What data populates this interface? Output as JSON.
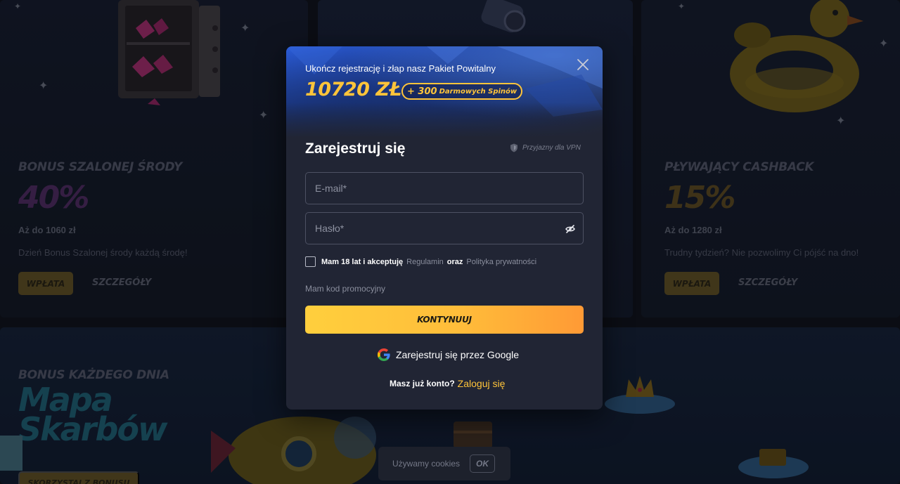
{
  "background": {
    "left_promo": {
      "title": "BONUS SZALONEJ ŚRODY",
      "percent": "40%",
      "upto": "Aż do 1060 zł",
      "description": "Dzień Bonus Szalonej środy każdą środę!",
      "deposit_label": "WPŁATA",
      "details_label": "SZCZEGÓŁY",
      "percent_color": "#5a2f6e"
    },
    "right_promo": {
      "title": "PŁYWAJĄCY CASHBACK",
      "percent": "15%",
      "upto": "Aż do 1280 zł",
      "description": "Trudny tydzień? Nie pozwolimy Ci pójść na dno!",
      "deposit_label": "WPŁATA",
      "details_label": "SZCZEGÓŁY",
      "percent_color": "#6b5320"
    },
    "bottom_promo": {
      "kicker": "BONUS KAŻDEGO DNIA",
      "title_line1": "Mapa",
      "title_line2": "Skarbów",
      "cta_label": "SKORZYSTAJ Z BONUSU"
    }
  },
  "cookie_bar": {
    "text": "Używamy cookies",
    "ok_label": "OK"
  },
  "modal": {
    "banner_lead": "Ukończ rejestrację i złap nasz Pakiet Powitalny",
    "amount": "10720 ZŁ",
    "spins_count": "+ 300",
    "spins_label": "Darmowych Spinów",
    "title": "Zarejestruj się",
    "vpn_label": "Przyjazny dla VPN",
    "email_placeholder": "E-mail*",
    "password_placeholder": "Hasło*",
    "terms_prefix": "Mam 18 lat i akceptuję",
    "terms_link1": "Regulamin",
    "terms_and": "oraz",
    "terms_link2": "Polityka prywatności",
    "promo_code_label": "Mam kod promocyjny",
    "continue_label": "KONTYNUUJ",
    "google_label": "Zarejestruj się przez Google",
    "login_question": "Masz już konto?",
    "login_link": "Zaloguj się"
  },
  "colors": {
    "accent_gold": "#ffc43a",
    "cta_gradient_start": "#ffcf3d",
    "cta_gradient_end": "#ff9a35",
    "modal_bg": "#212534"
  }
}
